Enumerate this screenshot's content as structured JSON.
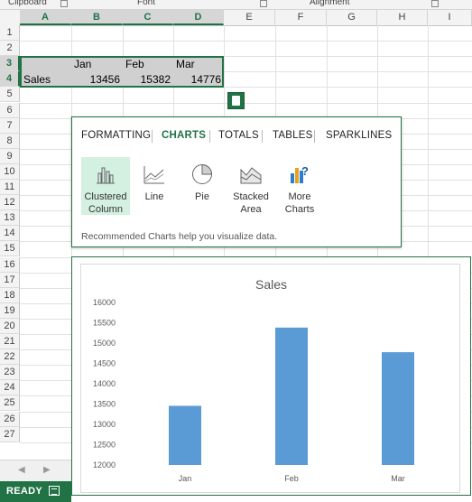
{
  "ribbon": {
    "groups": [
      "Clipboard",
      "Font",
      "Alignment"
    ]
  },
  "columns": [
    "A",
    "B",
    "C",
    "D",
    "E",
    "F",
    "G",
    "H",
    "I"
  ],
  "rows": [
    "1",
    "2",
    "3",
    "4",
    "5",
    "6",
    "7",
    "8",
    "9",
    "10",
    "11",
    "12",
    "13",
    "14",
    "15",
    "16",
    "17",
    "18",
    "19",
    "20",
    "21",
    "22",
    "23",
    "24",
    "25",
    "26",
    "27"
  ],
  "sheet": {
    "header_row": [
      "Jan",
      "Feb",
      "Mar"
    ],
    "data_row": {
      "label": "Sales",
      "values": [
        "13456",
        "15382",
        "14776"
      ]
    }
  },
  "quick_analysis": {
    "tabs": [
      "FORMATTING",
      "CHARTS",
      "TOTALS",
      "TABLES",
      "SPARKLINES"
    ],
    "active_tab": "CHARTS",
    "options": [
      {
        "label": "Clustered Column",
        "icon": "clustered-column-icon"
      },
      {
        "label": "Line",
        "icon": "line-chart-icon"
      },
      {
        "label": "Pie",
        "icon": "pie-chart-icon"
      },
      {
        "label": "Stacked Area",
        "icon": "stacked-area-icon"
      },
      {
        "label": "More Charts",
        "icon": "more-charts-icon"
      }
    ],
    "hint": "Recommended Charts help you visualize data."
  },
  "chart_data": {
    "type": "bar",
    "title": "Sales",
    "categories": [
      "Jan",
      "Feb",
      "Mar"
    ],
    "values": [
      13456,
      15382,
      14776
    ],
    "ylim": [
      12000,
      16000
    ],
    "yticks": [
      "12000",
      "12500",
      "13000",
      "13500",
      "14000",
      "14500",
      "15000",
      "15500",
      "16000"
    ],
    "grid": false,
    "bar_color": "#5b9bd5"
  },
  "status": {
    "mode": "READY"
  },
  "colors": {
    "accent": "#217346"
  }
}
